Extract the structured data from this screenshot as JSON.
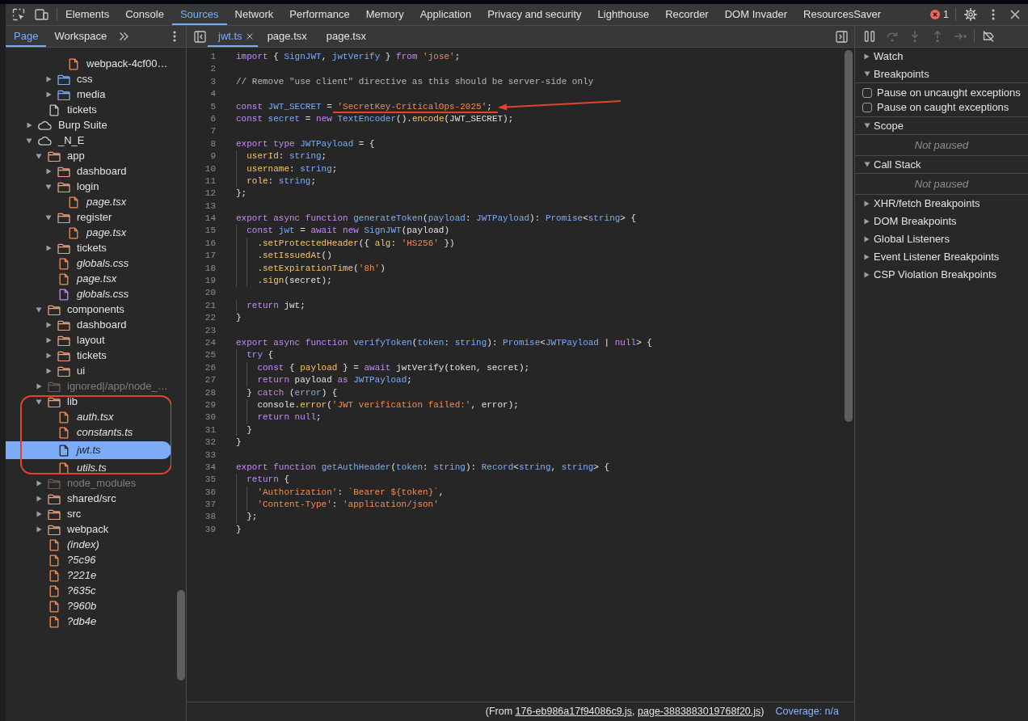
{
  "main_tabs": [
    {
      "label": "Elements",
      "selected": false
    },
    {
      "label": "Console",
      "selected": false
    },
    {
      "label": "Sources",
      "selected": true
    },
    {
      "label": "Network",
      "selected": false
    },
    {
      "label": "Performance",
      "selected": false
    },
    {
      "label": "Memory",
      "selected": false
    },
    {
      "label": "Application",
      "selected": false
    },
    {
      "label": "Privacy and security",
      "selected": false
    },
    {
      "label": "Lighthouse",
      "selected": false
    },
    {
      "label": "Recorder",
      "selected": false
    },
    {
      "label": "DOM Invader",
      "selected": false
    },
    {
      "label": "ResourcesSaver",
      "selected": false
    }
  ],
  "toolbar": {
    "error_count": "1"
  },
  "sidebar": {
    "tabs": [
      {
        "label": "Page",
        "selected": true
      },
      {
        "label": "Workspace",
        "selected": false
      }
    ],
    "tree": [
      {
        "children": [
          {
            "children": [
              {
                "children": [
                  {
                    "label": "webpack-4cf00…",
                    "kind": "script",
                    "selected": false
                  }
                ]
              },
              {
                "label": "css",
                "kind": "asset-folder",
                "expanded": false,
                "selected": false
              },
              {
                "label": "media",
                "kind": "asset-folder",
                "expanded": false,
                "selected": false
              }
            ]
          },
          {
            "label": "tickets",
            "kind": "document",
            "selected": false
          }
        ]
      },
      {
        "label": "Burp Suite",
        "kind": "origin",
        "expanded": false,
        "selected": false
      },
      {
        "label": "_N_E",
        "kind": "origin",
        "expanded": true,
        "selected": false,
        "children": [
          {
            "label": "app",
            "kind": "folder",
            "expanded": true,
            "selected": false,
            "circled": false,
            "children": [
              {
                "label": "dashboard",
                "kind": "folder",
                "expanded": false,
                "selected": false
              },
              {
                "label": "login",
                "kind": "folder",
                "expanded": true,
                "selected": false,
                "children": [
                  {
                    "label": "page.tsx",
                    "kind": "source",
                    "selected": false
                  }
                ]
              },
              {
                "label": "register",
                "kind": "folder",
                "expanded": true,
                "selected": false,
                "children": [
                  {
                    "label": "page.tsx",
                    "kind": "source",
                    "selected": false
                  }
                ]
              },
              {
                "label": "tickets",
                "kind": "folder",
                "expanded": false,
                "selected": false
              },
              {
                "label": "globals.css",
                "kind": "source",
                "selected": false
              },
              {
                "label": "page.tsx",
                "kind": "source",
                "selected": false
              },
              {
                "label": "globals.css",
                "kind": "stylesheet",
                "selected": false
              }
            ]
          },
          {
            "label": "components",
            "kind": "folder",
            "expanded": true,
            "selected": false,
            "circled": false,
            "children": [
              {
                "label": "dashboard",
                "kind": "folder",
                "expanded": false,
                "selected": false
              },
              {
                "label": "layout",
                "kind": "folder",
                "expanded": false,
                "selected": false
              },
              {
                "label": "tickets",
                "kind": "folder",
                "expanded": false,
                "selected": false
              },
              {
                "label": "ui",
                "kind": "folder",
                "expanded": false,
                "selected": false
              }
            ]
          },
          {
            "label": "ignored|/app/node_…",
            "kind": "ignored-folder",
            "expanded": false,
            "selected": false,
            "circled": false
          },
          {
            "label": "lib",
            "kind": "folder",
            "expanded": true,
            "selected": false,
            "circled": true,
            "children": [
              {
                "label": "auth.tsx",
                "kind": "source",
                "selected": false
              },
              {
                "label": "constants.ts",
                "kind": "source",
                "selected": false
              },
              {
                "label": "jwt.ts",
                "kind": "source",
                "selected": true
              },
              {
                "label": "utils.ts",
                "kind": "source",
                "selected": false
              }
            ]
          },
          {
            "label": "node_modules",
            "kind": "ignored-folder",
            "expanded": false,
            "selected": false,
            "circled": false
          },
          {
            "label": "shared/src",
            "kind": "folder",
            "expanded": false,
            "selected": false,
            "circled": false
          },
          {
            "label": "src",
            "kind": "folder",
            "expanded": false,
            "selected": false,
            "circled": false
          },
          {
            "label": "webpack",
            "kind": "folder",
            "expanded": false,
            "selected": false,
            "circled": false
          },
          {
            "label": "(index)",
            "kind": "source",
            "selected": false,
            "circled": false
          },
          {
            "label": "?5c96",
            "kind": "source",
            "selected": false,
            "circled": false
          },
          {
            "label": "?221e",
            "kind": "source",
            "selected": false,
            "circled": false
          },
          {
            "label": "?635c",
            "kind": "source",
            "selected": false,
            "circled": false
          },
          {
            "label": "?960b",
            "kind": "source",
            "selected": false,
            "circled": false
          },
          {
            "label": "?db4e",
            "kind": "source",
            "selected": false,
            "circled": false
          }
        ]
      }
    ]
  },
  "editor": {
    "tabs": [
      {
        "label": "jwt.ts",
        "selected": true
      },
      {
        "label": "page.tsx",
        "selected": false
      },
      {
        "label": "page.tsx",
        "selected": false
      }
    ],
    "lines": [
      {
        "number": "1",
        "marked": false,
        "tokens": [
          {
            "text": "import",
            "kind": "keyword"
          },
          {
            "text": " { ",
            "kind": "plain"
          },
          {
            "text": "SignJWT",
            "kind": "name"
          },
          {
            "text": ", ",
            "kind": "plain"
          },
          {
            "text": "jwtVerify",
            "kind": "name"
          },
          {
            "text": " } ",
            "kind": "plain"
          },
          {
            "text": "from ",
            "kind": "keyword"
          },
          {
            "text": "'jose'",
            "kind": "string"
          },
          {
            "text": ";",
            "kind": "plain"
          }
        ]
      },
      {
        "number": "2",
        "marked": false
      },
      {
        "number": "3",
        "marked": false,
        "tokens": [
          {
            "text": "// Remove \"use client\" directive as this should be server-side only",
            "kind": "comment"
          }
        ]
      },
      {
        "number": "4",
        "marked": false
      },
      {
        "number": "5",
        "marked": true,
        "tokens": [
          {
            "text": "const ",
            "kind": "keyword"
          },
          {
            "text": "JWT_SECRET",
            "kind": "name"
          },
          {
            "text": " = ",
            "kind": "plain"
          },
          {
            "text": "'SecretKey-CriticalOps-2025'",
            "kind": "string"
          },
          {
            "text": ";",
            "kind": "plain"
          }
        ]
      },
      {
        "number": "6",
        "marked": false,
        "tokens": [
          {
            "text": "const ",
            "kind": "keyword"
          },
          {
            "text": "secret",
            "kind": "name"
          },
          {
            "text": " = ",
            "kind": "plain"
          },
          {
            "text": "new ",
            "kind": "keyword"
          },
          {
            "text": "TextEncoder",
            "kind": "name"
          },
          {
            "text": "().",
            "kind": "plain"
          },
          {
            "text": "encode",
            "kind": "property"
          },
          {
            "text": "(JWT_SECRET);",
            "kind": "plain"
          }
        ]
      },
      {
        "number": "7",
        "marked": false
      },
      {
        "number": "8",
        "marked": false,
        "tokens": [
          {
            "text": "export type ",
            "kind": "keyword"
          },
          {
            "text": "JWTPayload",
            "kind": "name"
          },
          {
            "text": " = {",
            "kind": "plain"
          }
        ]
      },
      {
        "number": "9",
        "marked": false,
        "tokens": [
          {
            "text": "  userId",
            "kind": "property"
          },
          {
            "text": ": ",
            "kind": "plain"
          },
          {
            "text": "string",
            "kind": "name"
          },
          {
            "text": ";",
            "kind": "plain"
          }
        ]
      },
      {
        "number": "10",
        "marked": false,
        "tokens": [
          {
            "text": "  username",
            "kind": "property"
          },
          {
            "text": ": ",
            "kind": "plain"
          },
          {
            "text": "string",
            "kind": "name"
          },
          {
            "text": ";",
            "kind": "plain"
          }
        ]
      },
      {
        "number": "11",
        "marked": false,
        "tokens": [
          {
            "text": "  role",
            "kind": "property"
          },
          {
            "text": ": ",
            "kind": "plain"
          },
          {
            "text": "string",
            "kind": "name"
          },
          {
            "text": ";",
            "kind": "plain"
          }
        ]
      },
      {
        "number": "12",
        "marked": false,
        "tokens": [
          {
            "text": "};",
            "kind": "plain"
          }
        ]
      },
      {
        "number": "13",
        "marked": false
      },
      {
        "number": "14",
        "marked": false,
        "tokens": [
          {
            "text": "export async function ",
            "kind": "keyword"
          },
          {
            "text": "generateToken",
            "kind": "name"
          },
          {
            "text": "(",
            "kind": "plain"
          },
          {
            "text": "payload",
            "kind": "name"
          },
          {
            "text": ": ",
            "kind": "plain"
          },
          {
            "text": "JWTPayload",
            "kind": "name"
          },
          {
            "text": "): ",
            "kind": "plain"
          },
          {
            "text": "Promise",
            "kind": "name"
          },
          {
            "text": "<",
            "kind": "plain"
          },
          {
            "text": "string",
            "kind": "name"
          },
          {
            "text": "> {",
            "kind": "plain"
          }
        ]
      },
      {
        "number": "15",
        "marked": false,
        "tokens": [
          {
            "text": "  const ",
            "kind": "keyword"
          },
          {
            "text": "jwt",
            "kind": "name"
          },
          {
            "text": " = ",
            "kind": "plain"
          },
          {
            "text": "await new ",
            "kind": "keyword"
          },
          {
            "text": "SignJWT",
            "kind": "name"
          },
          {
            "text": "(payload)",
            "kind": "plain"
          }
        ]
      },
      {
        "number": "16",
        "marked": false,
        "tokens": [
          {
            "text": "    .",
            "kind": "plain"
          },
          {
            "text": "setProtectedHeader",
            "kind": "property"
          },
          {
            "text": "({ ",
            "kind": "plain"
          },
          {
            "text": "alg",
            "kind": "property"
          },
          {
            "text": ": ",
            "kind": "plain"
          },
          {
            "text": "'HS256'",
            "kind": "string"
          },
          {
            "text": " })",
            "kind": "plain"
          }
        ]
      },
      {
        "number": "17",
        "marked": false,
        "tokens": [
          {
            "text": "    .",
            "kind": "plain"
          },
          {
            "text": "setIssuedAt",
            "kind": "property"
          },
          {
            "text": "()",
            "kind": "plain"
          }
        ]
      },
      {
        "number": "18",
        "marked": false,
        "tokens": [
          {
            "text": "    .",
            "kind": "plain"
          },
          {
            "text": "setExpirationTime",
            "kind": "property"
          },
          {
            "text": "(",
            "kind": "plain"
          },
          {
            "text": "'8h'",
            "kind": "string"
          },
          {
            "text": ")",
            "kind": "plain"
          }
        ]
      },
      {
        "number": "19",
        "marked": false,
        "tokens": [
          {
            "text": "    .",
            "kind": "plain"
          },
          {
            "text": "sign",
            "kind": "property"
          },
          {
            "text": "(secret);",
            "kind": "plain"
          }
        ]
      },
      {
        "number": "20",
        "marked": false
      },
      {
        "number": "21",
        "marked": false,
        "tokens": [
          {
            "text": "  return",
            "kind": "keyword"
          },
          {
            "text": " jwt;",
            "kind": "plain"
          }
        ]
      },
      {
        "number": "22",
        "marked": false,
        "tokens": [
          {
            "text": "}",
            "kind": "plain"
          }
        ]
      },
      {
        "number": "23",
        "marked": false
      },
      {
        "number": "24",
        "marked": false,
        "tokens": [
          {
            "text": "export async function ",
            "kind": "keyword"
          },
          {
            "text": "verifyToken",
            "kind": "name"
          },
          {
            "text": "(",
            "kind": "plain"
          },
          {
            "text": "token",
            "kind": "name"
          },
          {
            "text": ": ",
            "kind": "plain"
          },
          {
            "text": "string",
            "kind": "name"
          },
          {
            "text": "): ",
            "kind": "plain"
          },
          {
            "text": "Promise",
            "kind": "name"
          },
          {
            "text": "<",
            "kind": "plain"
          },
          {
            "text": "JWTPayload",
            "kind": "name"
          },
          {
            "text": " | ",
            "kind": "plain"
          },
          {
            "text": "null",
            "kind": "keyword"
          },
          {
            "text": "> {",
            "kind": "plain"
          }
        ]
      },
      {
        "number": "25",
        "marked": false,
        "tokens": [
          {
            "text": "  try",
            "kind": "keyword"
          },
          {
            "text": " {",
            "kind": "plain"
          }
        ]
      },
      {
        "number": "26",
        "marked": false,
        "tokens": [
          {
            "text": "    const",
            "kind": "keyword"
          },
          {
            "text": " { ",
            "kind": "plain"
          },
          {
            "text": "payload",
            "kind": "property"
          },
          {
            "text": " } = ",
            "kind": "plain"
          },
          {
            "text": "await",
            "kind": "keyword"
          },
          {
            "text": " jwtVerify(token, secret);",
            "kind": "plain"
          }
        ]
      },
      {
        "number": "27",
        "marked": false,
        "tokens": [
          {
            "text": "    return",
            "kind": "keyword"
          },
          {
            "text": " payload ",
            "kind": "plain"
          },
          {
            "text": "as ",
            "kind": "keyword"
          },
          {
            "text": "JWTPayload",
            "kind": "name"
          },
          {
            "text": ";",
            "kind": "plain"
          }
        ]
      },
      {
        "number": "28",
        "marked": false,
        "tokens": [
          {
            "text": "  } ",
            "kind": "plain"
          },
          {
            "text": "catch",
            "kind": "keyword"
          },
          {
            "text": " (",
            "kind": "plain"
          },
          {
            "text": "error",
            "kind": "name"
          },
          {
            "text": ") {",
            "kind": "plain"
          }
        ]
      },
      {
        "number": "29",
        "marked": false,
        "tokens": [
          {
            "text": "    console.",
            "kind": "plain"
          },
          {
            "text": "error",
            "kind": "property"
          },
          {
            "text": "(",
            "kind": "plain"
          },
          {
            "text": "'JWT verification failed:'",
            "kind": "string"
          },
          {
            "text": ", error);",
            "kind": "plain"
          }
        ]
      },
      {
        "number": "30",
        "marked": false,
        "tokens": [
          {
            "text": "    return null",
            "kind": "keyword"
          },
          {
            "text": ";",
            "kind": "plain"
          }
        ]
      },
      {
        "number": "31",
        "marked": false,
        "tokens": [
          {
            "text": "  }",
            "kind": "plain"
          }
        ]
      },
      {
        "number": "32",
        "marked": false,
        "tokens": [
          {
            "text": "}",
            "kind": "plain"
          }
        ]
      },
      {
        "number": "33",
        "marked": false
      },
      {
        "number": "34",
        "marked": false,
        "tokens": [
          {
            "text": "export function ",
            "kind": "keyword"
          },
          {
            "text": "getAuthHeader",
            "kind": "name"
          },
          {
            "text": "(",
            "kind": "plain"
          },
          {
            "text": "token",
            "kind": "name"
          },
          {
            "text": ": ",
            "kind": "plain"
          },
          {
            "text": "string",
            "kind": "name"
          },
          {
            "text": "): ",
            "kind": "plain"
          },
          {
            "text": "Record",
            "kind": "name"
          },
          {
            "text": "<",
            "kind": "plain"
          },
          {
            "text": "string",
            "kind": "name"
          },
          {
            "text": ", ",
            "kind": "plain"
          },
          {
            "text": "string",
            "kind": "name"
          },
          {
            "text": "> {",
            "kind": "plain"
          }
        ]
      },
      {
        "number": "35",
        "marked": false,
        "tokens": [
          {
            "text": "  return",
            "kind": "keyword"
          },
          {
            "text": " {",
            "kind": "plain"
          }
        ]
      },
      {
        "number": "36",
        "marked": false,
        "tokens": [
          {
            "text": "    'Authorization'",
            "kind": "string"
          },
          {
            "text": ": ",
            "kind": "plain"
          },
          {
            "text": "`Bearer ${token}`",
            "kind": "string"
          },
          {
            "text": ",",
            "kind": "plain"
          }
        ]
      },
      {
        "number": "37",
        "marked": false,
        "tokens": [
          {
            "text": "    'Content-Type'",
            "kind": "string"
          },
          {
            "text": ": ",
            "kind": "plain"
          },
          {
            "text": "'application/json'",
            "kind": "string"
          }
        ]
      },
      {
        "number": "38",
        "marked": false,
        "tokens": [
          {
            "text": "  };",
            "kind": "plain"
          }
        ]
      },
      {
        "number": "39",
        "marked": false,
        "tokens": [
          {
            "text": "}",
            "kind": "plain"
          }
        ]
      }
    ],
    "source_note": [
      {
        "text": "(From "
      },
      {
        "link": "176-eb986a17f94086c9.js"
      },
      {
        "text": ", "
      },
      {
        "link": "page-3883883019768f20.js"
      },
      {
        "text": ")"
      }
    ],
    "coverage": "Coverage: n/a"
  },
  "debugger": {
    "controls": [
      {
        "kind": "pause",
        "disabled": false
      },
      {
        "kind": "step-over",
        "disabled": true
      },
      {
        "kind": "step-into",
        "disabled": true
      },
      {
        "kind": "step-out",
        "disabled": true
      },
      {
        "kind": "step",
        "disabled": true
      },
      {
        "kind": "deactivate",
        "disabled": false
      }
    ],
    "sections": [
      {
        "title": "Watch",
        "expanded": false
      },
      {
        "title": "Breakpoints",
        "expanded": true,
        "checkboxes": [
          {
            "label": "Pause on uncaught exceptions",
            "checked": false
          },
          {
            "label": "Pause on caught exceptions",
            "checked": false
          }
        ]
      },
      {
        "title": "Scope",
        "expanded": true,
        "message": "Not paused"
      },
      {
        "title": "Call Stack",
        "expanded": true,
        "message": "Not paused"
      },
      {
        "title": "XHR/fetch Breakpoints",
        "expanded": false
      },
      {
        "title": "DOM Breakpoints",
        "expanded": false
      },
      {
        "title": "Global Listeners",
        "expanded": false
      },
      {
        "title": "Event Listener Breakpoints",
        "expanded": false
      },
      {
        "title": "CSP Violation Breakpoints",
        "expanded": false
      }
    ]
  }
}
